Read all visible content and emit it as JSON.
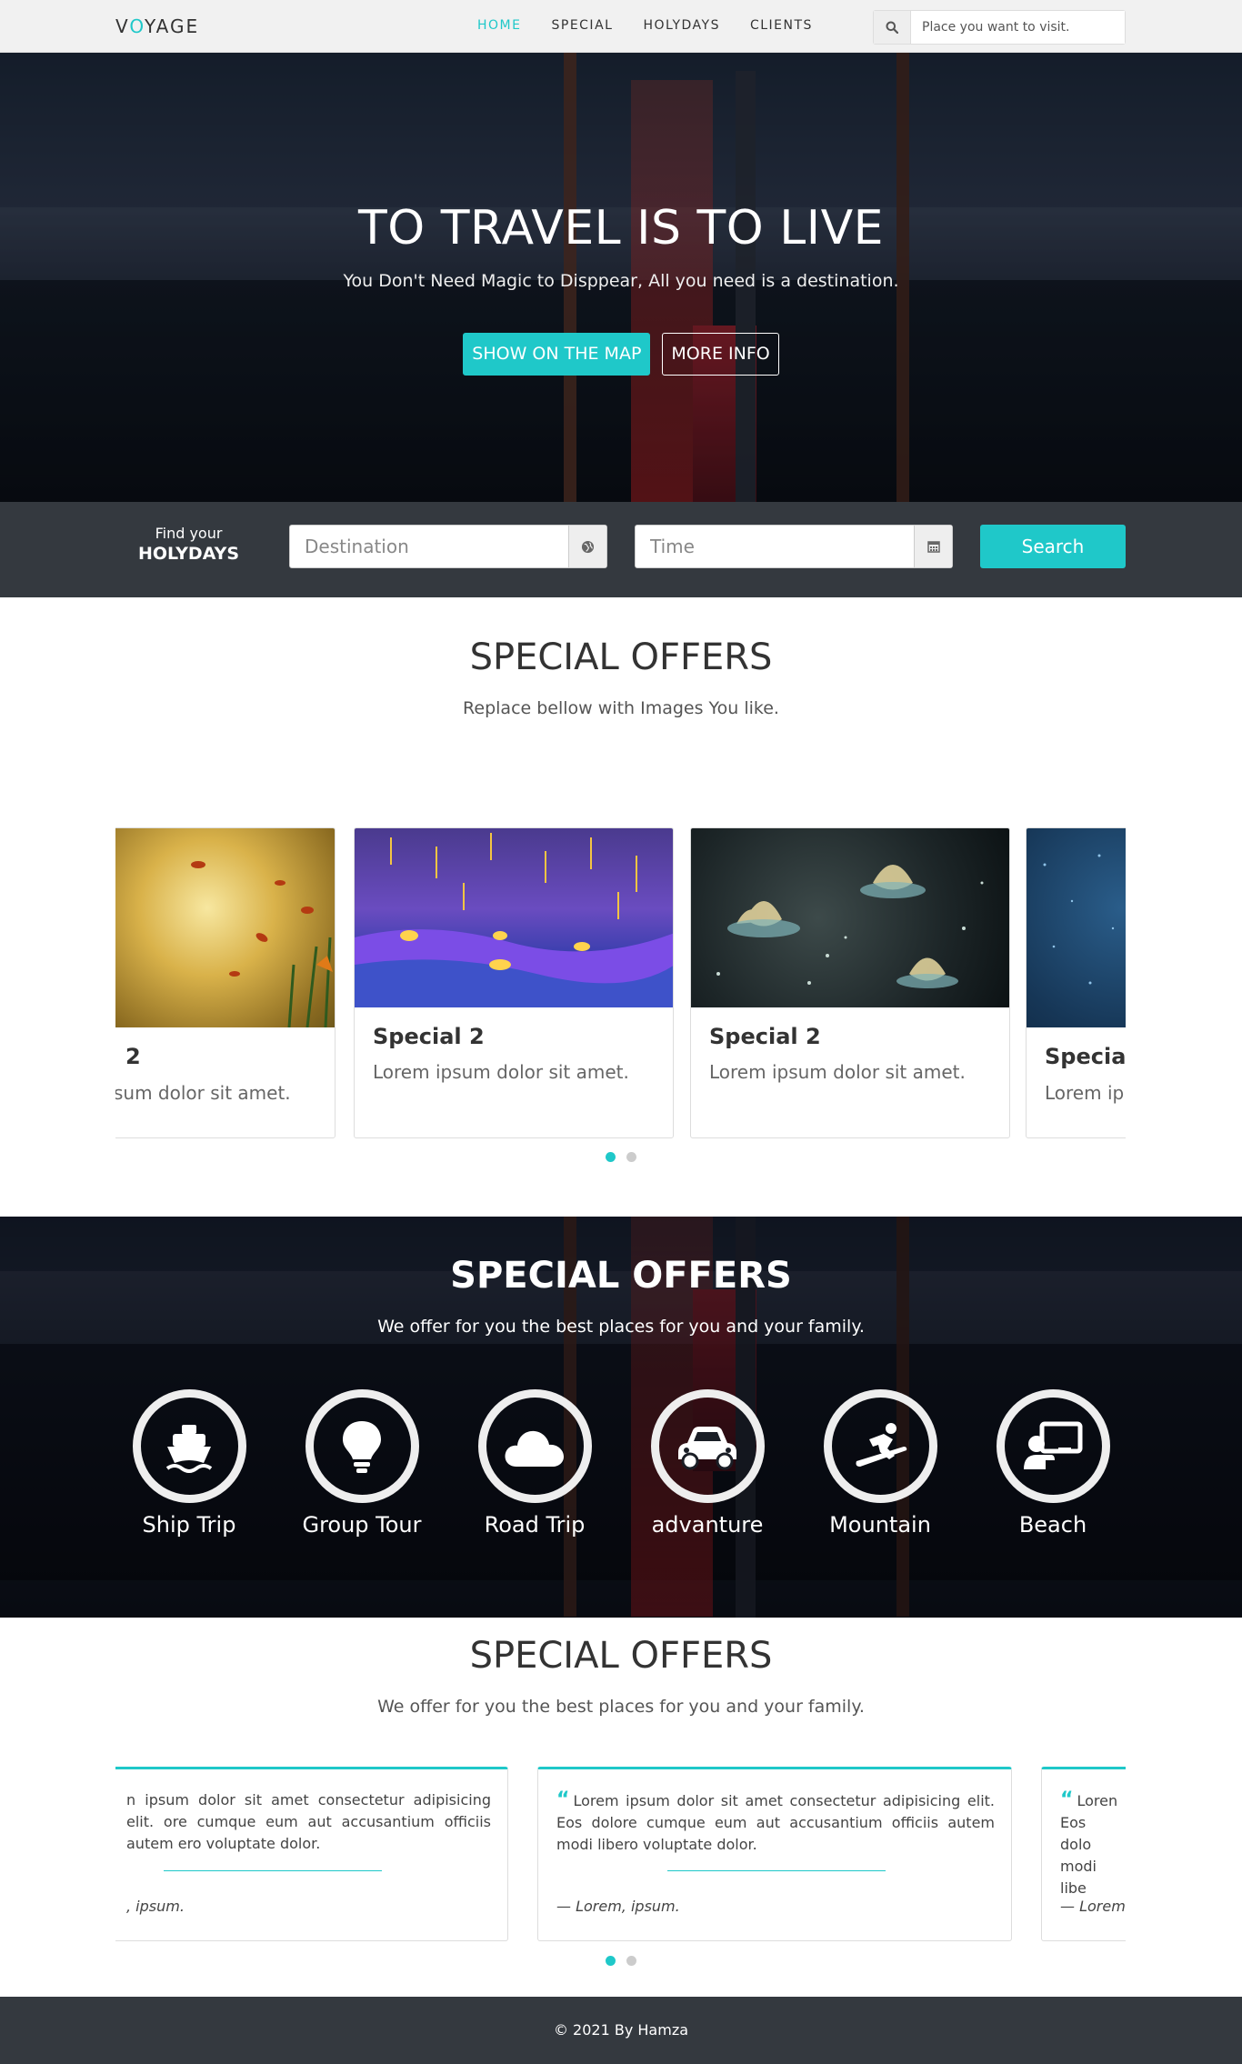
{
  "nav": {
    "brand_pre": "V",
    "brand_o": "O",
    "brand_post": "YAGE",
    "links": [
      "HOME",
      "SPECIAL",
      "HOLYDAYS",
      "CLIENTS"
    ],
    "active": "HOME",
    "search_placeholder": "Place you want to visit.",
    "search_icon": "search-icon"
  },
  "hero": {
    "title": "TO TRAVEL IS TO LIVE",
    "subtitle": "You Don't Need Magic to Disppear, All you need is a destination.",
    "primary_button": "SHOW ON THE MAP",
    "secondary_button": "MORE INFO"
  },
  "find": {
    "label_line1": "Find your",
    "label_line2": "HOLYDAYS",
    "destination_placeholder": "Destination",
    "destination_icon": "globe-icon",
    "time_placeholder": "Time",
    "time_icon": "calendar-icon",
    "search_button": "Search"
  },
  "offers": {
    "title": "SPECIAL OFFERS",
    "subtitle": "Replace bellow with Images You like.",
    "cards": [
      {
        "title": "2",
        "text": "sum dolor sit amet."
      },
      {
        "title": "Special 2",
        "text": "Lorem ipsum dolor sit amet."
      },
      {
        "title": "Special 2",
        "text": "Lorem ipsum dolor sit amet."
      },
      {
        "title": "Special",
        "text": "Lorem ip"
      }
    ]
  },
  "features": {
    "title": "SPECIAL OFFERS",
    "subtitle": "We offer for you the best places for you and your family.",
    "items": [
      {
        "label": "Ship Trip",
        "icon": "ship-icon"
      },
      {
        "label": "Group Tour",
        "icon": "lightbulb-icon"
      },
      {
        "label": "Road Trip",
        "icon": "cloud-icon"
      },
      {
        "label": "advanture",
        "icon": "car-icon"
      },
      {
        "label": "Mountain",
        "icon": "snowboarding-icon"
      },
      {
        "label": "Beach",
        "icon": "chalkboard-teacher-icon"
      }
    ]
  },
  "testimonials": {
    "title": "SPECIAL OFFERS",
    "subtitle": "We offer for you the best places for you and your family.",
    "cards": [
      {
        "text": "n ipsum dolor sit amet consectetur adipisicing elit. ore cumque eum aut accusantium officiis autem ero voluptate dolor.",
        "author": ", ipsum."
      },
      {
        "text": "Lorem ipsum dolor sit amet consectetur adipisicing elit. Eos dolore cumque eum aut accusantium officiis autem modi libero voluptate dolor.",
        "author": "— Lorem, ipsum."
      },
      {
        "text": "Loren Eos dolo modi libe",
        "author": "— Lorem"
      }
    ]
  },
  "footer": {
    "text": "© 2021 By Hamza"
  },
  "colors": {
    "accent": "#1fc8c9",
    "dark": "#34393f"
  }
}
